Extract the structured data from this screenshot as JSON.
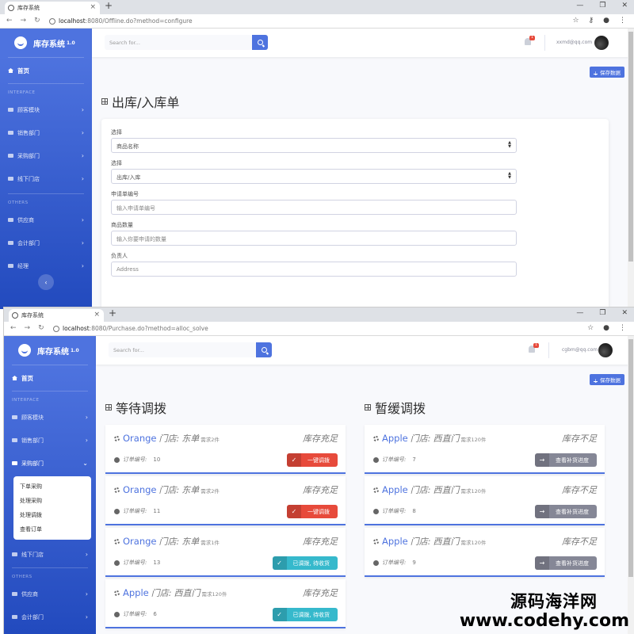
{
  "windows": [
    {
      "tab_title": "库存系统",
      "url_host": "localhost",
      "url_path": ":8080/Offline.do?method=configure",
      "brand": "库存系统",
      "brand_version": "1.0",
      "search_placeholder": "Search for...",
      "bell_count": "1",
      "email": "xxmd@qq.com",
      "save_label": "保存数据",
      "page_title": "出库/入库单",
      "form": {
        "label1": "选择",
        "select1": "商品名称",
        "label2": "选择",
        "select2": "出库/入库",
        "label3": "申请单编号",
        "input3": "输入申请单编号",
        "label4": "商品数量",
        "input4": "输入你要申请的数量",
        "label5": "负责人",
        "input5": "Address"
      }
    },
    {
      "tab_title": "库存系统",
      "url_host": "localhost",
      "url_path": ":8080/Purchase.do?method=alloc_solve",
      "brand": "库存系统",
      "brand_version": "1.0",
      "search_placeholder": "Search for...",
      "bell_count": "1",
      "email": "cgbm@qq.com",
      "save_label": "保存数据",
      "submenu": [
        "下单采购",
        "处理采购",
        "处理调拨",
        "查看订单"
      ],
      "left_title": "等待调拨",
      "right_title": "暂缓调拨",
      "left_orders": [
        {
          "product": "Orange",
          "store": "门店:",
          "store_name": "东单",
          "need": "需求2件",
          "stock": "库存充足",
          "order_label": "订单编号:",
          "order_no": "10",
          "action": "一键调拨",
          "check": "✓",
          "kind": "red"
        },
        {
          "product": "Orange",
          "store": "门店:",
          "store_name": "东单",
          "need": "需求2件",
          "stock": "库存充足",
          "order_label": "订单编号:",
          "order_no": "11",
          "action": "一键调拨",
          "check": "✓",
          "kind": "red"
        },
        {
          "product": "Orange",
          "store": "门店:",
          "store_name": "东单",
          "need": "需求1件",
          "stock": "库存充足",
          "order_label": "订单编号:",
          "order_no": "13",
          "action": "已调拨, 待收货",
          "check": "✓",
          "kind": "teal"
        },
        {
          "product": "Apple",
          "store": "门店:",
          "store_name": "西直门",
          "need": "需求120件",
          "stock": "库存充足",
          "order_label": "订单编号:",
          "order_no": "6",
          "action": "已调拨, 待收货",
          "check": "✓",
          "kind": "teal"
        }
      ],
      "right_orders": [
        {
          "product": "Apple",
          "store": "门店:",
          "store_name": "西直门",
          "need": "需求120件",
          "stock": "库存不足",
          "order_label": "订单编号:",
          "order_no": "7",
          "action": "查看补货进度",
          "arrow": "→",
          "kind": "gray"
        },
        {
          "product": "Apple",
          "store": "门店:",
          "store_name": "西直门",
          "need": "需求120件",
          "stock": "库存不足",
          "order_label": "订单编号:",
          "order_no": "8",
          "action": "查看补货进度",
          "arrow": "→",
          "kind": "gray"
        },
        {
          "product": "Apple",
          "store": "门店:",
          "store_name": "西直门",
          "need": "需求120件",
          "stock": "库存不足",
          "order_label": "订单编号:",
          "order_no": "9",
          "action": "查看补货进度",
          "arrow": "→",
          "kind": "gray"
        }
      ]
    }
  ],
  "sidebar": {
    "home": "首页",
    "head_interface": "INTERFACE",
    "head_others": "OTHERS",
    "items_a": [
      "顾客模块",
      "销售部门",
      "采购部门",
      "线下门店"
    ],
    "items_b": [
      "供应商",
      "会计部门",
      "经理"
    ]
  },
  "watermark": {
    "line1": "源码海洋网",
    "line2": "www.codehy.com"
  },
  "colors": {
    "primary": "#4e73df",
    "danger": "#e74a3b",
    "info": "#36b9cc",
    "secondary": "#858796"
  }
}
